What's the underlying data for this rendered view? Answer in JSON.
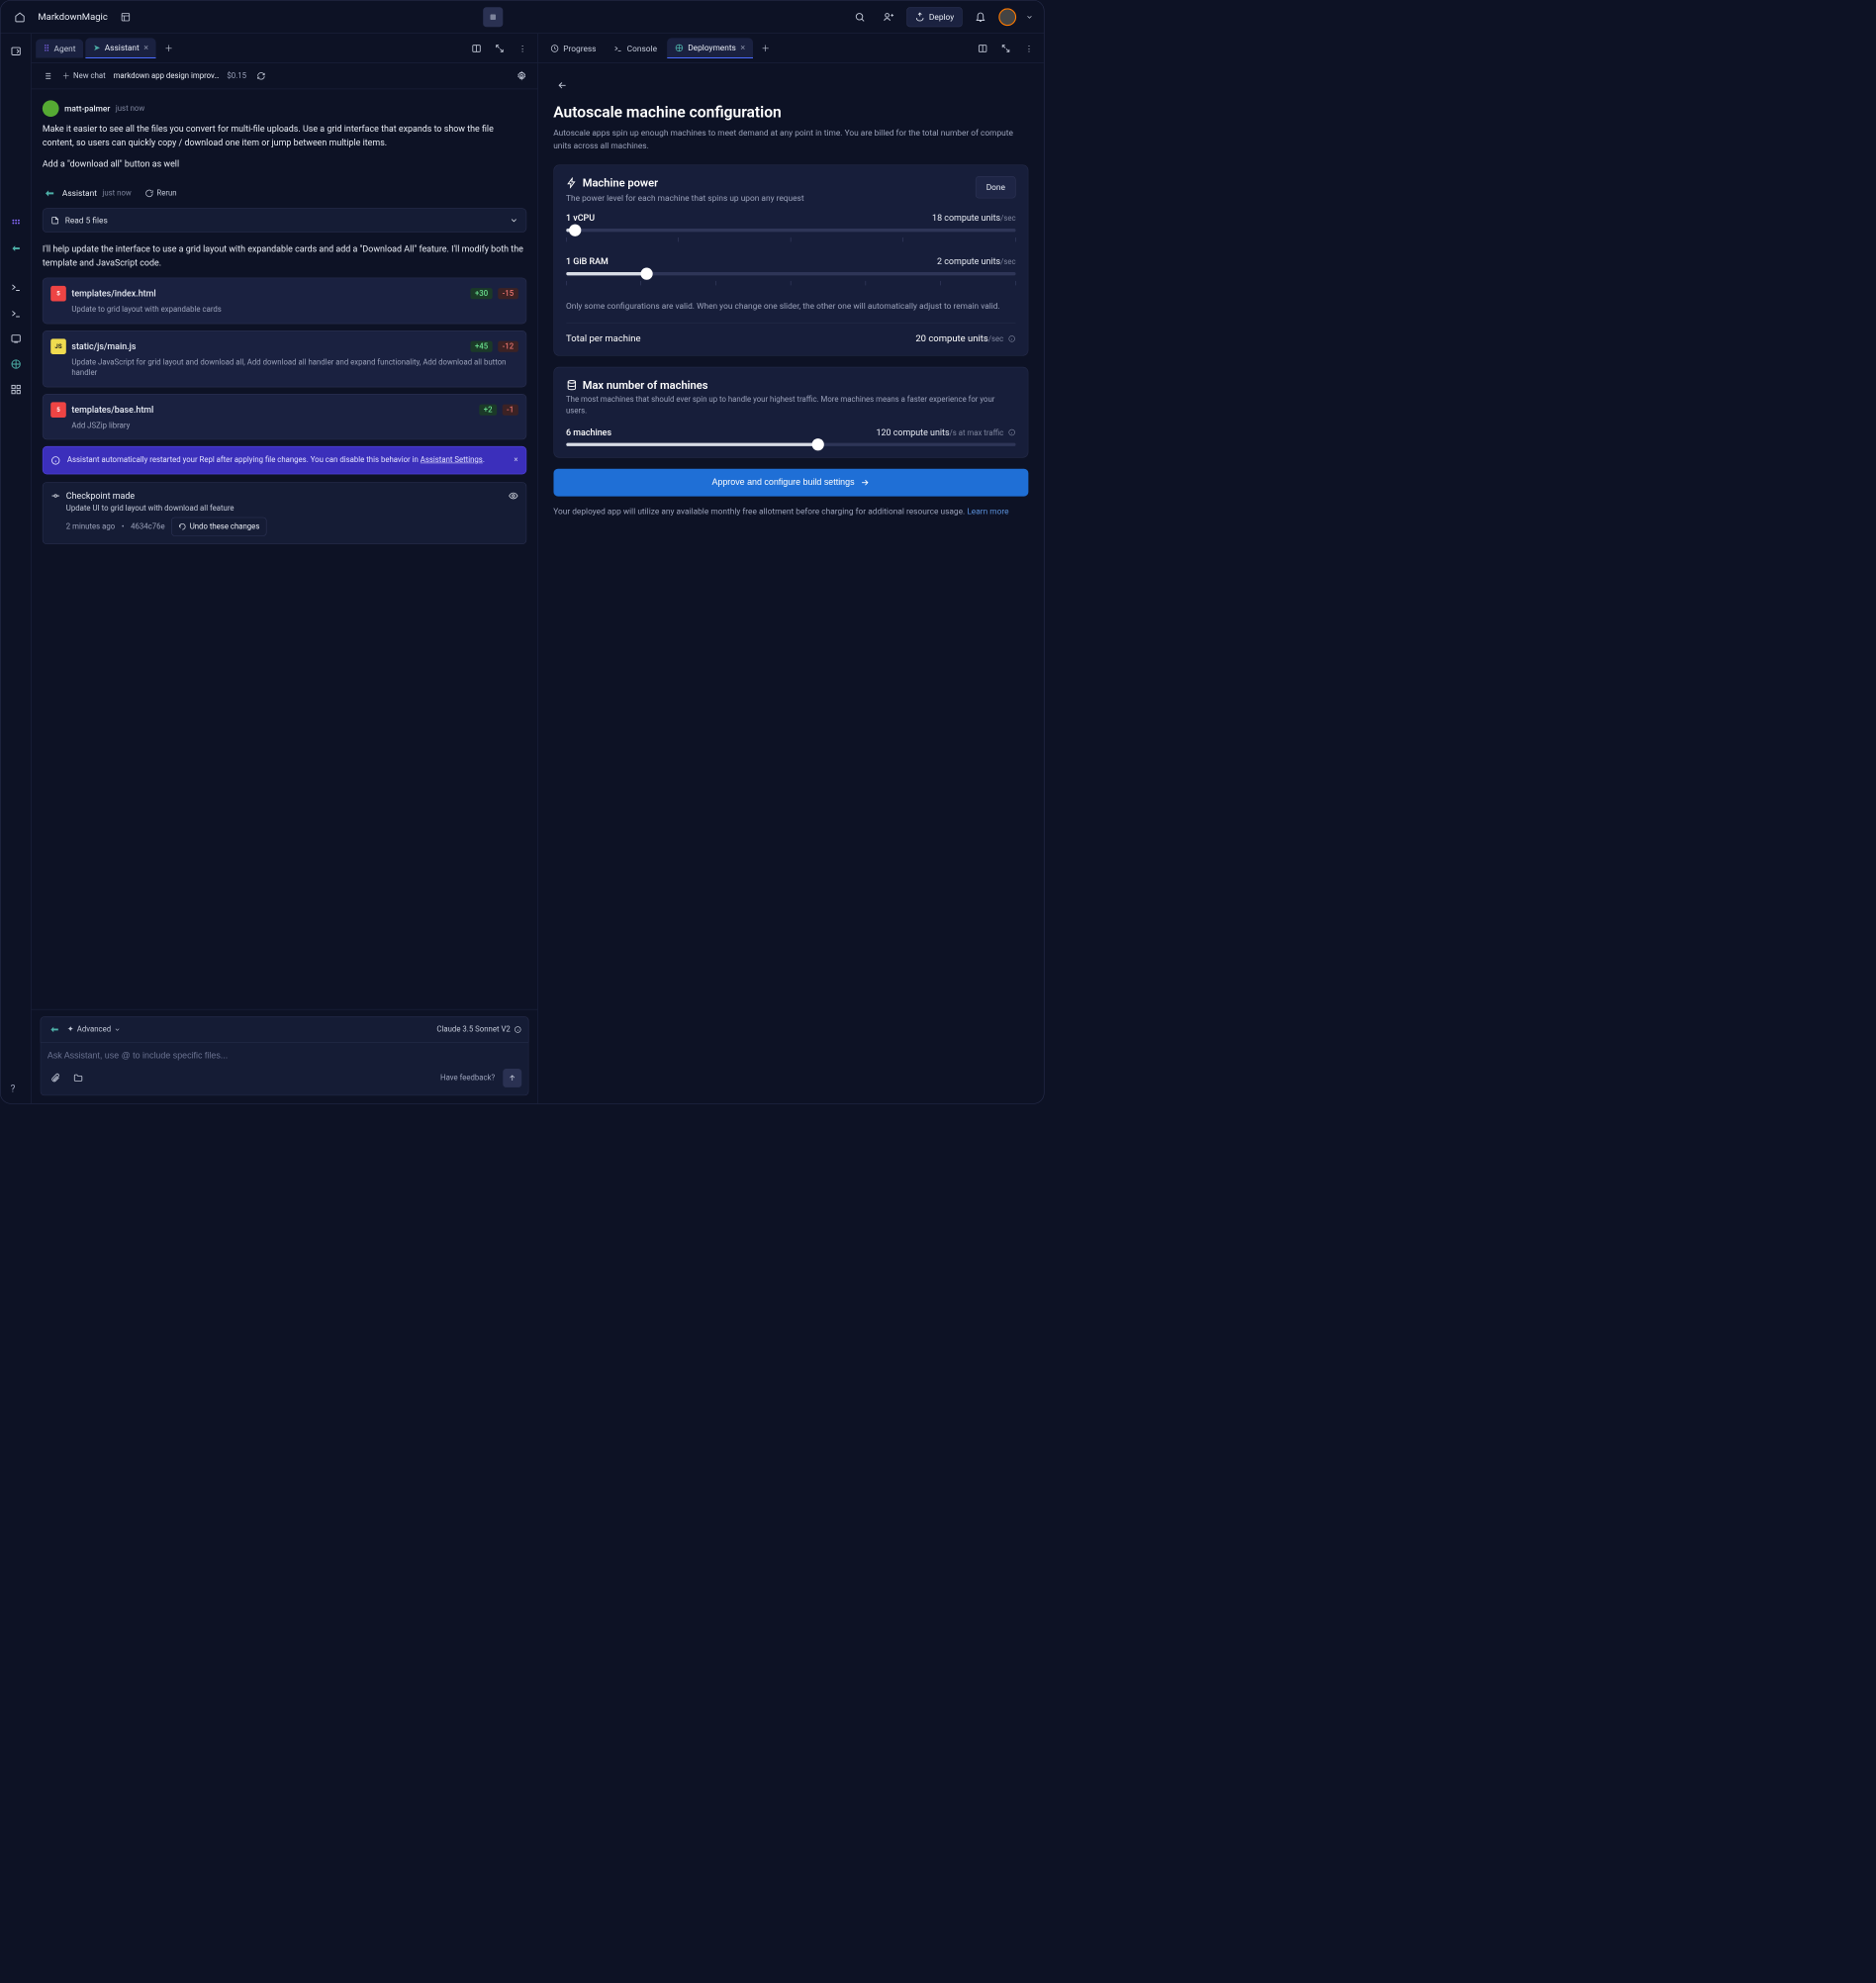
{
  "app": {
    "title": "MarkdownMagic",
    "deploy_label": "Deploy"
  },
  "left_tabs": [
    {
      "label": "Agent",
      "active": false,
      "closable": false
    },
    {
      "label": "Assistant",
      "active": true,
      "closable": true
    }
  ],
  "right_tabs": [
    {
      "label": "Progress",
      "active": false,
      "closable": false
    },
    {
      "label": "Console",
      "active": false,
      "closable": false
    },
    {
      "label": "Deployments",
      "active": true,
      "closable": true
    }
  ],
  "subbar": {
    "new_chat": "New chat",
    "conversation_title": "markdown app design improv…",
    "cost": "$0.15"
  },
  "conversation": {
    "user": {
      "name": "matt-palmer",
      "time": "just now",
      "body1": "Make it easier to see all the files you convert for multi-file uploads. Use a grid interface that expands to show the file content, so users can quickly copy / download one item or jump between multiple items.",
      "body2": "Add a \"download all\" button as well"
    },
    "assistant": {
      "name": "Assistant",
      "time": "just now",
      "rerun": "Rerun",
      "read_files": "Read 5 files",
      "intro": "I'll help update the interface to use a grid layout with expandable cards and add a \"Download All\" feature. I'll modify both the template and JavaScript code."
    },
    "files": [
      {
        "icon": "html",
        "name": "templates/index.html",
        "add": "+30",
        "del": "-15",
        "desc": "Update to grid layout with expandable cards"
      },
      {
        "icon": "js",
        "name": "static/js/main.js",
        "add": "+45",
        "del": "-12",
        "desc": "Update JavaScript for grid layout and download all, Add download all handler and expand functionality, Add download all button handler"
      },
      {
        "icon": "html",
        "name": "templates/base.html",
        "add": "+2",
        "del": "-1",
        "desc": "Add JSZip library"
      }
    ],
    "banner": {
      "text_pre": "Assistant automatically restarted your Repl after applying file changes. You can disable this behavior in ",
      "link": "Assistant Settings",
      "text_post": "."
    },
    "checkpoint": {
      "title": "Checkpoint made",
      "desc": "Update UI to grid layout with download all feature",
      "time": "2 minutes ago",
      "hash": "4634c76e",
      "undo": "Undo these changes"
    }
  },
  "composer": {
    "advanced": "Advanced",
    "model": "Claude 3.5 Sonnet V2",
    "placeholder": "Ask Assistant, use @ to include specific files...",
    "feedback": "Have feedback?"
  },
  "deploy": {
    "title": "Autoscale machine configuration",
    "subtitle": "Autoscale apps spin up enough machines to meet demand at any point in time. You are billed for the total number of compute units across all machines.",
    "machine_power": {
      "title": "Machine power",
      "desc": "The power level for each machine that spins up upon any request",
      "done": "Done",
      "vcpu_label": "1 vCPU",
      "vcpu_cost": "18 compute units",
      "vcpu_unit": "/sec",
      "ram_label": "1 GiB RAM",
      "ram_cost": "2 compute units",
      "ram_unit": "/sec",
      "note": "Only some configurations are valid. When you change one slider, the other one will automatically adjust to remain valid.",
      "total_label": "Total per machine",
      "total_val": "20 compute units",
      "total_unit": "/sec"
    },
    "max_machines": {
      "title": "Max number of machines",
      "desc": "The most machines that should ever spin up to handle your highest traffic. More machines means a faster experience for your users.",
      "count_label": "6 machines",
      "cost": "120 compute units",
      "unit": "/s at max traffic"
    },
    "approve": "Approve and configure build settings",
    "footnote_pre": "Your deployed app will utilize any available monthly free allotment before charging for additional resource usage. ",
    "learn_more": "Learn more"
  }
}
